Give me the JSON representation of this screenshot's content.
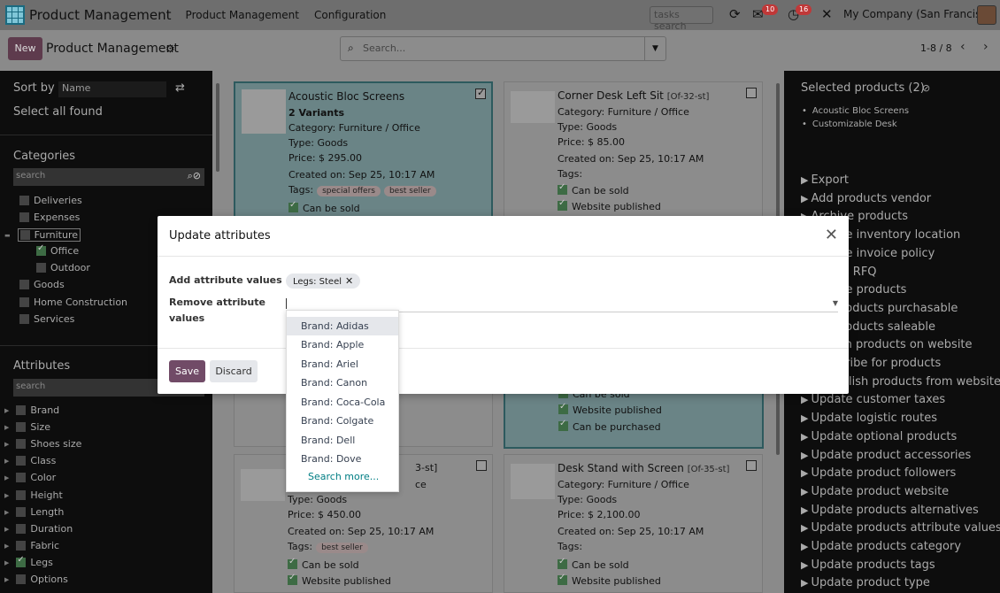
{
  "topbar": {
    "app_title": "Product Management",
    "menu": [
      "Product Management",
      "Configuration"
    ],
    "search_placeholder": "tasks search",
    "msg_badge": "10",
    "activity_badge": "16",
    "company": "My Company (San Francisco)"
  },
  "control": {
    "new_label": "New",
    "title": "Product Management",
    "search_placeholder": "Search...",
    "pager": "1-8 / 8"
  },
  "left": {
    "sort_label": "Sort by",
    "sort_value": "Name",
    "select_all": "Select all found",
    "categories_title": "Categories",
    "cat_search": "search",
    "categories": [
      "Deliveries",
      "Expenses",
      "Furniture",
      "Office",
      "Outdoor",
      "Goods",
      "Home Construction",
      "Services"
    ],
    "attributes_title": "Attributes",
    "attr_search": "search",
    "attributes": [
      "Brand",
      "Size",
      "Shoes size",
      "Class",
      "Color",
      "Height",
      "Length",
      "Duration",
      "Fabric",
      "Legs",
      "Options"
    ]
  },
  "cards": [
    {
      "title": "Acoustic Bloc Screens",
      "sub": "2 Variants",
      "category": "Category: Furniture / Office",
      "type": "Type: Goods",
      "price": "Price: $ 295.00",
      "created": "Created on: Sep 25, 10:17 AM",
      "tags_label": "Tags:",
      "tags": [
        "special offers",
        "best seller"
      ],
      "flags": [
        "Can be sold"
      ]
    },
    {
      "title": "Corner Desk Left Sit",
      "ref": "[Of-32-st]",
      "category": "Category: Furniture / Office",
      "type": "Type: Goods",
      "price": "Price: $ 85.00",
      "created": "Created on: Sep 25, 10:17 AM",
      "tags_label": "Tags:",
      "flags": [
        "Can be sold",
        "Website published"
      ]
    },
    {
      "flags": [
        "Can be sold",
        "Website published",
        "Can be purchased"
      ]
    },
    {
      "ref": "3-st]",
      "category": "ce",
      "type": "Type: Goods",
      "price": "Price: $ 450.00",
      "created": "Created on: Sep 25, 10:17 AM",
      "tags_label": "Tags:",
      "tags": [
        "best seller"
      ],
      "flags": [
        "Can be sold",
        "Website published"
      ]
    },
    {
      "title": "Desk Stand with Screen",
      "ref": "[Of-35-st]",
      "category": "Category: Furniture / Office",
      "type": "Type: Goods",
      "price": "Price: $ 2,100.00",
      "created": "Created on: Sep 25, 10:17 AM",
      "tags_label": "Tags:",
      "flags": [
        "Can be sold",
        "Website published"
      ]
    }
  ],
  "right": {
    "selected_title": "Selected products (2)",
    "selected": [
      "Acoustic Bloc Screens",
      "Customizable Desk"
    ],
    "actions": [
      "Export",
      "Add products vendor",
      "Archive products",
      "Update inventory location",
      "Update invoice policy",
      "Create RFQ",
      "Update products",
      "Set products purchasable",
      "Set products saleable",
      "Publish products on website",
      "Subscribe for products",
      "Unpublish products from website",
      "Update customer taxes",
      "Update logistic routes",
      "Update optional products",
      "Update product accessories",
      "Update product followers",
      "Update product website",
      "Update products alternatives",
      "Update products attribute values",
      "Update products category",
      "Update products tags",
      "Update product type"
    ]
  },
  "modal": {
    "title": "Update attributes",
    "add_label": "Add attribute values",
    "add_chip": "Legs: Steel",
    "remove_label": "Remove attribute values",
    "save": "Save",
    "discard": "Discard"
  },
  "dropdown": {
    "items": [
      "Brand: Adidas",
      "Brand: Apple",
      "Brand: Ariel",
      "Brand: Canon",
      "Brand: Coca-Cola",
      "Brand: Colgate",
      "Brand: Dell",
      "Brand: Dove"
    ],
    "more": "Search more..."
  }
}
